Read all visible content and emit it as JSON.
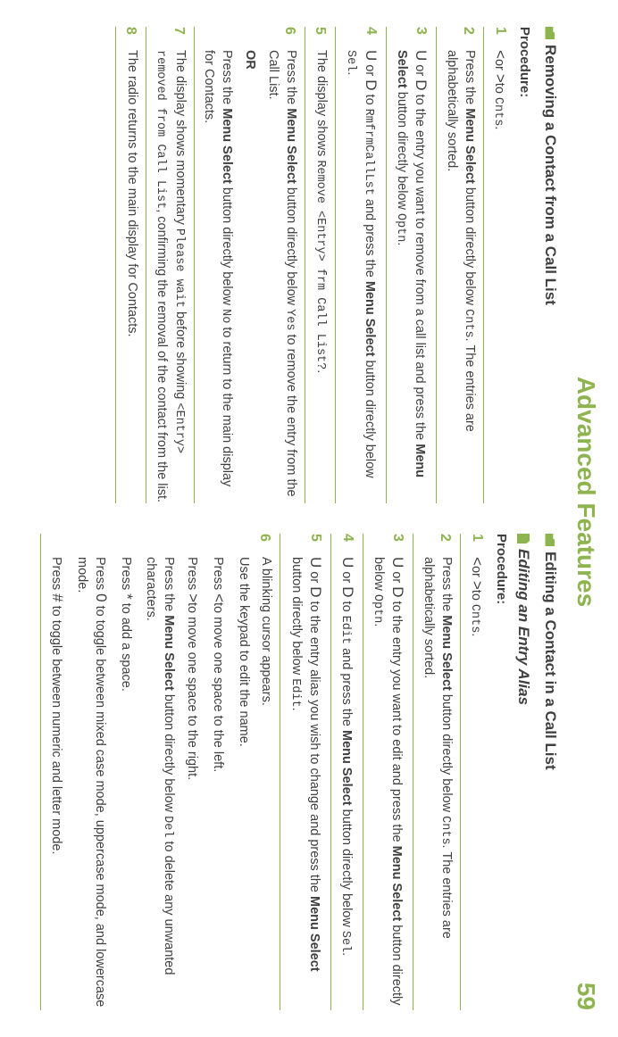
{
  "header": {
    "title": "Advanced Features",
    "page_number": "59"
  },
  "left": {
    "section_title": "Removing a Contact from a Call List",
    "procedure_label": "Procedure:",
    "steps": [
      {
        "n": "1",
        "parts": [
          {
            "t": "k",
            "v": "<"
          },
          {
            "t": "x",
            "v": "or "
          },
          {
            "t": "k",
            "v": ">"
          },
          {
            "t": "x",
            "v": "to "
          },
          {
            "t": "m",
            "v": "Cnts"
          },
          {
            "t": "x",
            "v": "."
          }
        ]
      },
      {
        "n": "2",
        "parts": [
          {
            "t": "x",
            "v": "Press the "
          },
          {
            "t": "b",
            "v": "Menu Select"
          },
          {
            "t": "x",
            "v": " button directly below "
          },
          {
            "t": "m",
            "v": "Cnts"
          },
          {
            "t": "x",
            "v": ". The entries are alphabetically sorted."
          }
        ]
      },
      {
        "n": "3",
        "parts": [
          {
            "t": "k",
            "v": "U"
          },
          {
            "t": "x",
            "v": " or "
          },
          {
            "t": "k",
            "v": "D"
          },
          {
            "t": "x",
            "v": " to the entry you want to remove from a call list and press the "
          },
          {
            "t": "b",
            "v": "Menu Select"
          },
          {
            "t": "x",
            "v": " button directly below "
          },
          {
            "t": "m",
            "v": "Optn"
          },
          {
            "t": "x",
            "v": "."
          }
        ]
      },
      {
        "n": "4",
        "parts": [
          {
            "t": "k",
            "v": "U"
          },
          {
            "t": "x",
            "v": " or "
          },
          {
            "t": "k",
            "v": "D"
          },
          {
            "t": "x",
            "v": " to "
          },
          {
            "t": "m",
            "v": "RmfrmCallLst"
          },
          {
            "t": "x",
            "v": " and press the "
          },
          {
            "t": "b",
            "v": "Menu Select"
          },
          {
            "t": "x",
            "v": " button directly below "
          },
          {
            "t": "m",
            "v": "Sel"
          },
          {
            "t": "x",
            "v": "."
          }
        ]
      },
      {
        "n": "5",
        "parts": [
          {
            "t": "x",
            "v": "The display shows "
          },
          {
            "t": "m",
            "v": "Remove <Entry> frm Call List?"
          },
          {
            "t": "x",
            "v": "."
          }
        ]
      },
      {
        "n": "6",
        "paras": [
          [
            {
              "t": "x",
              "v": "Press the "
            },
            {
              "t": "b",
              "v": "Menu Select"
            },
            {
              "t": "x",
              "v": " button directly below "
            },
            {
              "t": "m",
              "v": "Yes"
            },
            {
              "t": "x",
              "v": " to remove the entry from the Call List."
            }
          ],
          [
            {
              "t": "b",
              "v": "OR"
            }
          ],
          [
            {
              "t": "x",
              "v": "Press the "
            },
            {
              "t": "b",
              "v": "Menu Select"
            },
            {
              "t": "x",
              "v": " button directly below "
            },
            {
              "t": "m",
              "v": "No"
            },
            {
              "t": "x",
              "v": " to return to the main display for Contacts."
            }
          ]
        ]
      },
      {
        "n": "7",
        "parts": [
          {
            "t": "x",
            "v": "The display shows momentary "
          },
          {
            "t": "m",
            "v": "Please wait"
          },
          {
            "t": "x",
            "v": " before showing "
          },
          {
            "t": "m",
            "v": "<Entry> removed from Call List"
          },
          {
            "t": "x",
            "v": ", confirming the removal of the contact from the list."
          }
        ]
      },
      {
        "n": "8",
        "parts": [
          {
            "t": "x",
            "v": "The radio returns to the main display for Contacts."
          }
        ]
      }
    ]
  },
  "right": {
    "section_title": "Editing a Contact in a Call List",
    "sub_title": "Editing an Entry Alias",
    "procedure_label": "Procedure:",
    "steps": [
      {
        "n": "1",
        "parts": [
          {
            "t": "k",
            "v": "<"
          },
          {
            "t": "x",
            "v": "or "
          },
          {
            "t": "k",
            "v": ">"
          },
          {
            "t": "x",
            "v": "to "
          },
          {
            "t": "m",
            "v": "Cnts"
          },
          {
            "t": "x",
            "v": "."
          }
        ]
      },
      {
        "n": "2",
        "parts": [
          {
            "t": "x",
            "v": "Press the "
          },
          {
            "t": "b",
            "v": "Menu Select"
          },
          {
            "t": "x",
            "v": " button directly below "
          },
          {
            "t": "m",
            "v": "Cnts"
          },
          {
            "t": "x",
            "v": ". The entries are alphabetically sorted."
          }
        ]
      },
      {
        "n": "3",
        "parts": [
          {
            "t": "k",
            "v": "U"
          },
          {
            "t": "x",
            "v": " or "
          },
          {
            "t": "k",
            "v": "D"
          },
          {
            "t": "x",
            "v": " to the entry you want to edit and press the "
          },
          {
            "t": "b",
            "v": "Menu Select"
          },
          {
            "t": "x",
            "v": " button directly below "
          },
          {
            "t": "m",
            "v": "Optn"
          },
          {
            "t": "x",
            "v": "."
          }
        ]
      },
      {
        "n": "4",
        "parts": [
          {
            "t": "k",
            "v": "U"
          },
          {
            "t": "x",
            "v": " or "
          },
          {
            "t": "k",
            "v": "D"
          },
          {
            "t": "x",
            "v": " to "
          },
          {
            "t": "m",
            "v": "Edit"
          },
          {
            "t": "x",
            "v": " and press the "
          },
          {
            "t": "b",
            "v": "Menu Select"
          },
          {
            "t": "x",
            "v": " button directly below "
          },
          {
            "t": "m",
            "v": "Sel"
          },
          {
            "t": "x",
            "v": "."
          }
        ]
      },
      {
        "n": "5",
        "parts": [
          {
            "t": "k",
            "v": "U"
          },
          {
            "t": "x",
            "v": " or "
          },
          {
            "t": "k",
            "v": "D"
          },
          {
            "t": "x",
            "v": " to the entry alias you wish to change and press the "
          },
          {
            "t": "b",
            "v": "Menu Select"
          },
          {
            "t": "x",
            "v": " button directly below "
          },
          {
            "t": "m",
            "v": "Edit"
          },
          {
            "t": "x",
            "v": "."
          }
        ]
      },
      {
        "n": "6",
        "paras": [
          [
            {
              "t": "x",
              "v": "A blinking cursor appears."
            }
          ],
          [
            {
              "t": "x",
              "v": "Use the keypad to edit the name."
            }
          ],
          [
            {
              "t": "x",
              "v": "Press "
            },
            {
              "t": "k",
              "v": "<"
            },
            {
              "t": "x",
              "v": "to move one space to the left."
            }
          ],
          [
            {
              "t": "x",
              "v": "Press "
            },
            {
              "t": "k",
              "v": ">"
            },
            {
              "t": "x",
              "v": "to move one space to the right."
            }
          ],
          [
            {
              "t": "x",
              "v": "Press the "
            },
            {
              "t": "b",
              "v": "Menu Select"
            },
            {
              "t": "x",
              "v": " button directly below "
            },
            {
              "t": "m",
              "v": "Del"
            },
            {
              "t": "x",
              "v": " to delete any unwanted characters."
            }
          ],
          [
            {
              "t": "x",
              "v": "Press "
            },
            {
              "t": "k",
              "v": "*"
            },
            {
              "t": "x",
              "v": " to add a space."
            }
          ],
          [
            {
              "t": "x",
              "v": "Press "
            },
            {
              "t": "k",
              "v": "0"
            },
            {
              "t": "x",
              "v": " to toggle between mixed case mode, uppercase mode, and lowercase mode."
            }
          ],
          [
            {
              "t": "x",
              "v": "Press "
            },
            {
              "t": "k",
              "v": "#"
            },
            {
              "t": "x",
              "v": " to toggle between numeric and letter mode."
            }
          ]
        ]
      }
    ]
  }
}
